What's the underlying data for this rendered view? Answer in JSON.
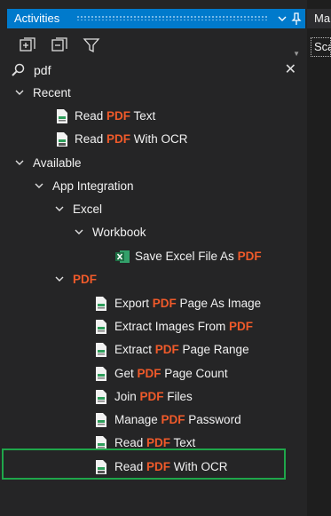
{
  "panel": {
    "title": "Activities",
    "pin_icon": "pin-icon",
    "dropdown_icon": "dropdown-icon"
  },
  "right_panel": {
    "tab_label": "Ma",
    "sub_label": "Sca"
  },
  "toolbar": {
    "expand_all_icon": "expand-all-icon",
    "collapse_all_icon": "collapse-all-icon",
    "filter_icon": "filter-icon"
  },
  "search": {
    "value": "pdf",
    "search_icon": "search-icon",
    "clear_icon": "close-icon"
  },
  "tree": {
    "recent": {
      "label": "Recent",
      "items": [
        {
          "pre": "Read ",
          "hl": "PDF",
          "post": " Text"
        },
        {
          "pre": "Read ",
          "hl": "PDF",
          "post": " With OCR"
        }
      ]
    },
    "available": {
      "label": "Available",
      "app_integration": "App Integration",
      "excel": "Excel",
      "workbook": "Workbook",
      "excel_item": {
        "pre": "Save Excel File As ",
        "hl": "PDF",
        "post": ""
      },
      "pdf_group": "PDF",
      "pdf_items": [
        {
          "pre": "Export ",
          "hl": "PDF",
          "post": " Page As Image"
        },
        {
          "pre": "Extract Images From ",
          "hl": "PDF",
          "post": ""
        },
        {
          "pre": "Extract ",
          "hl": "PDF",
          "post": " Page Range"
        },
        {
          "pre": "Get ",
          "hl": "PDF",
          "post": " Page Count"
        },
        {
          "pre": "Join ",
          "hl": "PDF",
          "post": " Files"
        },
        {
          "pre": "Manage ",
          "hl": "PDF",
          "post": " Password"
        },
        {
          "pre": "Read ",
          "hl": "PDF",
          "post": " Text"
        },
        {
          "pre": "Read ",
          "hl": "PDF",
          "post": " With OCR"
        }
      ]
    }
  },
  "colors": {
    "accent": "#007acc",
    "highlight_text": "#f05a2a",
    "selection_border": "#1fa64a",
    "background": "#252526"
  }
}
